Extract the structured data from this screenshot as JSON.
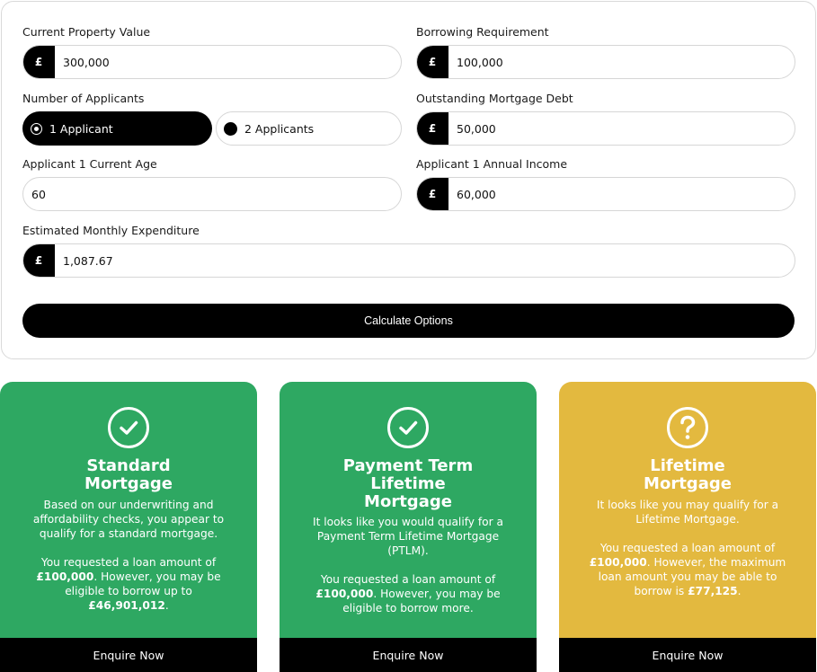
{
  "form": {
    "property_value": {
      "label": "Current Property Value",
      "prefix": "£",
      "value": "300,000"
    },
    "borrowing": {
      "label": "Borrowing Requirement",
      "prefix": "£",
      "value": "100,000"
    },
    "applicants": {
      "label": "Number of Applicants",
      "option1": "1 Applicant",
      "option2": "2 Applicants",
      "selected": "1 Applicant"
    },
    "outstanding_debt": {
      "label": "Outstanding Mortgage Debt",
      "prefix": "£",
      "value": "50,000"
    },
    "age": {
      "label": "Applicant 1 Current Age",
      "value": "60"
    },
    "income": {
      "label": "Applicant 1 Annual Income",
      "prefix": "£",
      "value": "60,000"
    },
    "expenditure": {
      "label": "Estimated Monthly Expenditure",
      "prefix": "£",
      "value": "1,087.67"
    },
    "calculate_label": "Calculate Options"
  },
  "results": [
    {
      "status": "check",
      "color": "#2ea862",
      "title": "Standard Mortgage",
      "para1": "Based on our underwriting and affordability checks, you appear to qualify for a standard mortgage.",
      "para2_a": "You requested a loan amount of ",
      "para2_amount": "£100,000",
      "para2_b": ". However, you may be eligible to borrow up to ",
      "para2_max": "£46,901,012",
      "para2_c": ".",
      "button": "Enquire Now"
    },
    {
      "status": "check",
      "color": "#2ea862",
      "title": "Payment Term Lifetime Mortgage",
      "para1": "It looks like you would qualify for a Payment Term Lifetime Mortgage (PTLM).",
      "para2_a": "You requested a loan amount of ",
      "para2_amount": "£100,000",
      "para2_b": ". However, you may be eligible to borrow more.",
      "button": "Enquire Now"
    },
    {
      "status": "question",
      "color": "#e3b93f",
      "title": "Lifetime Mortgage",
      "para1": "It looks like you may qualify for a Lifetime Mortgage.",
      "para2_a": "You requested a loan amount of ",
      "para2_amount": "£100,000",
      "para2_b": ". However, the maximum loan amount you may be able to borrow is ",
      "para2_max": "£77,125",
      "para2_c": ".",
      "button": "Enquire Now"
    }
  ]
}
